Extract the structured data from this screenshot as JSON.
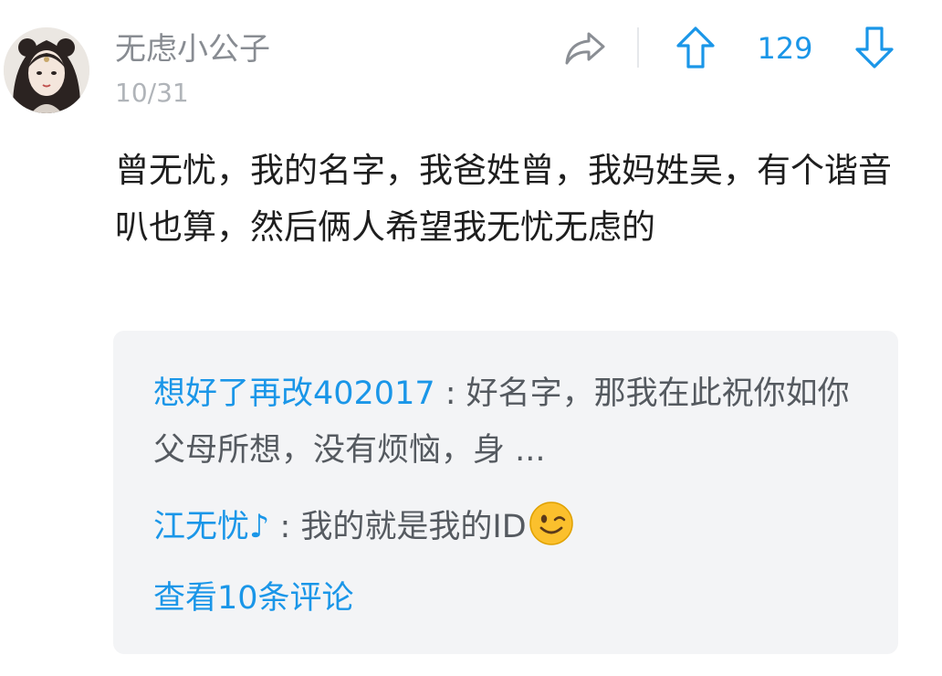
{
  "post": {
    "username": "无虑小公子",
    "date": "10/31",
    "vote_count": "129",
    "content": "曾无忧，我的名字，我爸姓曾，我妈姓吴，有个谐音叭也算，然后俩人希望我无忧无虑的"
  },
  "icons": {
    "share": "share-icon",
    "upvote": "arrow-up-icon",
    "downvote": "arrow-down-icon",
    "emoji": "wink-emoji-icon"
  },
  "colors": {
    "accent": "#1a96e8",
    "reply_bg": "#f3f4f6"
  },
  "replies": [
    {
      "user": "想好了再改402017",
      "separator": " : ",
      "text": "好名字，那我在此祝你如你父母所想，没有烦恼，身 ..."
    },
    {
      "user": "江无忧♪",
      "separator": " : ",
      "text": "我的就是我的ID"
    }
  ],
  "view_more": "查看10条评论"
}
